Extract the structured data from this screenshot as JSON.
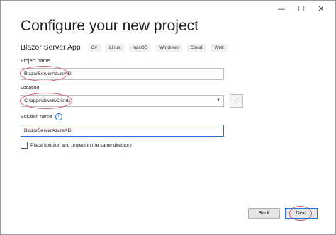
{
  "window": {
    "minimize_glyph": "—",
    "maximize_glyph": "☐",
    "close_glyph": "✕"
  },
  "page": {
    "title": "Configure your new project"
  },
  "template": {
    "name": "Blazor Server App",
    "tags": [
      "C#",
      "Linux",
      "macOS",
      "Windows",
      "Cloud",
      "Web"
    ]
  },
  "project_name": {
    "label": "Project name",
    "value": "BlazorServerAzureAD"
  },
  "location": {
    "label": "Location",
    "value": "C:\\apps\\devkit\\Clients",
    "browse_label": "..."
  },
  "solution_name": {
    "label": "Solution name",
    "value": "BlazorServerAzureAD",
    "info_glyph": "i"
  },
  "same_directory": {
    "label": "Place solution and project in the same directory",
    "checked": false
  },
  "footer": {
    "back_label": "Back",
    "next_label": "Next"
  },
  "colors": {
    "highlight": "#d1586e",
    "focus": "#1f78d1"
  }
}
